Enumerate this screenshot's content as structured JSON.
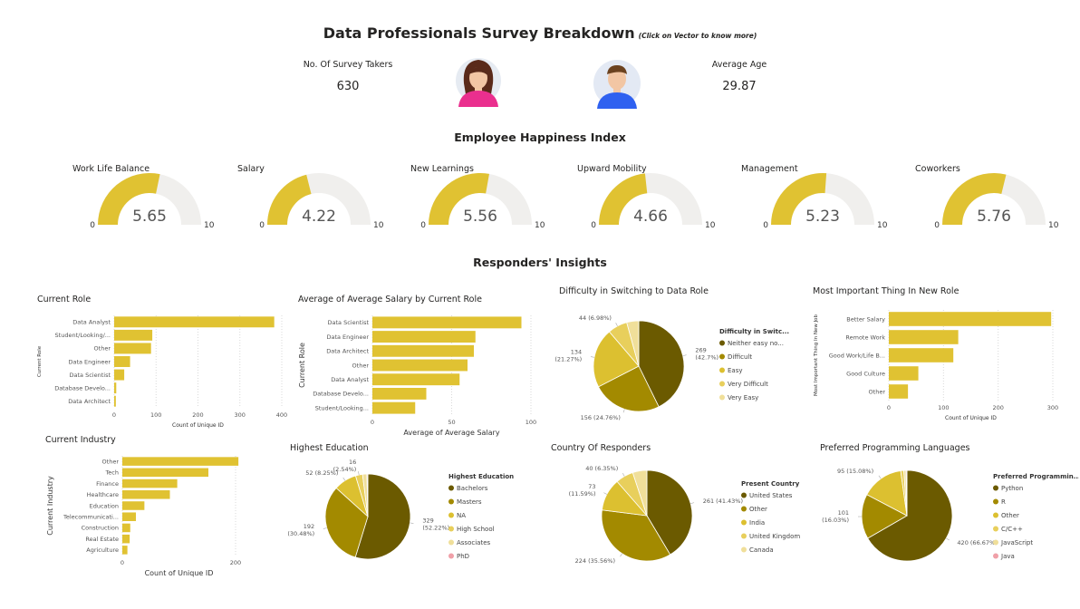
{
  "header": {
    "title": "Data Professionals Survey Breakdown",
    "note": "(Click on Vector to know more)"
  },
  "kpis": {
    "survey_takers_label": "No. Of Survey Takers",
    "survey_takers_value": "630",
    "average_age_label": "Average Age",
    "average_age_value": "29.87"
  },
  "happiness": {
    "section_title": "Employee Happiness Index",
    "gauges": [
      {
        "title": "Work Life Balance",
        "value": "5.65",
        "min": "0",
        "max": "10",
        "fraction": 0.565
      },
      {
        "title": "Salary",
        "value": "4.22",
        "min": "0",
        "max": "10",
        "fraction": 0.422
      },
      {
        "title": "New Learnings",
        "value": "5.56",
        "min": "0",
        "max": "10",
        "fraction": 0.556
      },
      {
        "title": "Upward Mobility",
        "value": "4.66",
        "min": "0",
        "max": "10",
        "fraction": 0.466
      },
      {
        "title": "Management",
        "value": "5.23",
        "min": "0",
        "max": "10",
        "fraction": 0.523
      },
      {
        "title": "Coworkers",
        "value": "5.76",
        "min": "0",
        "max": "10",
        "fraction": 0.576
      }
    ]
  },
  "insights": {
    "section_title": "Responders' Insights"
  },
  "colors": {
    "bar": "#e0c232",
    "gauge_fill": "#e0c232",
    "gauge_track": "#f0efed",
    "pie": [
      "#6b5a00",
      "#a38a00",
      "#dcc030",
      "#e8cf5c",
      "#f0df9a",
      "#f0a0a8"
    ]
  },
  "chart_data": [
    {
      "id": "current_role",
      "type": "bar",
      "orientation": "horizontal",
      "title": "Current Role",
      "categories": [
        "Data Analyst",
        "Student/Looking/...",
        "Other",
        "Data Engineer",
        "Data Scientist",
        "Database Develo...",
        "Data Architect"
      ],
      "values": [
        382,
        91,
        88,
        38,
        24,
        5,
        4
      ],
      "xlabel": "Count of Unique ID",
      "ylabel": "Current Role",
      "xlim": [
        0,
        400
      ],
      "ticks": [
        "0",
        "100",
        "200",
        "300",
        "400"
      ],
      "grid": true
    },
    {
      "id": "avg_salary_by_role",
      "type": "bar",
      "orientation": "horizontal",
      "title": "Average of Average Salary by Current Role",
      "categories": [
        "Data Scientist",
        "Data Engineer",
        "Data Architect",
        "Other",
        "Data Analyst",
        "Database Develo...",
        "Student/Looking..."
      ],
      "values": [
        94,
        65,
        64,
        60,
        55,
        34,
        27
      ],
      "xlabel": "Average of Average Salary",
      "ylabel": "Current Role",
      "xlim": [
        0,
        100
      ],
      "ticks": [
        "0",
        "50",
        "100"
      ],
      "grid": true
    },
    {
      "id": "difficulty_switch",
      "type": "pie",
      "title": "Difficulty in Switching to Data Role",
      "legend_title": "Difficulty in Switc...",
      "legend_position": "right",
      "categories": [
        "Neither easy no...",
        "Difficult",
        "Easy",
        "Very Difficult",
        "Very Easy"
      ],
      "values": [
        269,
        156,
        134,
        44,
        27
      ],
      "labels": [
        "269\n(42.7%)",
        "156 (24.76%)",
        "134\n(21.27%)",
        "44 (6.98%)",
        ""
      ]
    },
    {
      "id": "most_important",
      "type": "bar",
      "orientation": "horizontal",
      "title": "Most Important Thing In New Role",
      "categories": [
        "Better Salary",
        "Remote Work",
        "Good Work/Life B...",
        "Good Culture",
        "Other"
      ],
      "values": [
        297,
        127,
        118,
        54,
        35
      ],
      "xlabel": "Count of Unique ID",
      "ylabel": "Most Important Thing In New Job",
      "xlim": [
        0,
        300
      ],
      "ticks": [
        "0",
        "100",
        "200",
        "300"
      ],
      "grid": true
    },
    {
      "id": "current_industry",
      "type": "bar",
      "orientation": "horizontal",
      "title": "Current Industry",
      "categories": [
        "Other",
        "Tech",
        "Finance",
        "Healthcare",
        "Education",
        "Telecommunicati...",
        "Construction",
        "Real Estate",
        "Agriculture"
      ],
      "values": [
        205,
        152,
        97,
        84,
        39,
        24,
        14,
        13,
        9
      ],
      "xlabel": "Count of Unique ID",
      "ylabel": "Current Industry",
      "xlim": [
        0,
        200
      ],
      "ticks": [
        "0",
        "200"
      ],
      "grid": true
    },
    {
      "id": "highest_education",
      "type": "pie",
      "title": "Highest Education",
      "legend_title": "Highest Education",
      "legend_position": "right",
      "categories": [
        "Bachelors",
        "Masters",
        "NA",
        "High School",
        "Associates",
        "PhD"
      ],
      "values": [
        329,
        192,
        52,
        16,
        10,
        2
      ],
      "labels": [
        "329\n(52.22%)",
        "192\n(30.48%)",
        "52 (8.25%)",
        "16\n(2.54%)",
        "",
        ""
      ]
    },
    {
      "id": "country",
      "type": "pie",
      "title": "Country Of Responders",
      "legend_title": "Present Country",
      "legend_position": "right",
      "categories": [
        "United States",
        "Other",
        "India",
        "United Kingdom",
        "Canada"
      ],
      "values": [
        261,
        224,
        73,
        40,
        32
      ],
      "labels": [
        "261 (41.43%)",
        "224 (35.56%)",
        "73\n(11.59%)",
        "40 (6.35%)",
        ""
      ]
    },
    {
      "id": "languages",
      "type": "pie",
      "title": "Preferred Programming Languages",
      "legend_title": "Preferred Programmin...",
      "legend_position": "right",
      "categories": [
        "Python",
        "R",
        "Other",
        "C/C++",
        "JavaScript",
        "Java"
      ],
      "values": [
        420,
        101,
        95,
        7,
        5,
        2
      ],
      "labels": [
        "420 (66.67%)",
        "101\n(16.03%)",
        "95 (15.08%)",
        "",
        "",
        ""
      ]
    }
  ]
}
